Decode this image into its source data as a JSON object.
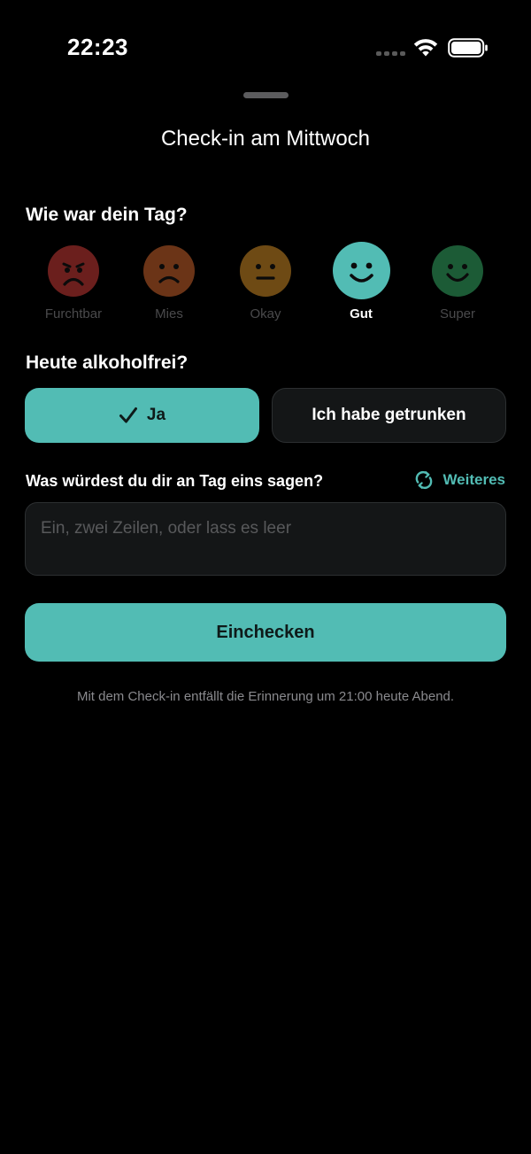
{
  "status_bar": {
    "time": "22:23"
  },
  "sheet": {
    "title": "Check-in am Mittwoch"
  },
  "mood": {
    "question": "Wie war dein Tag?",
    "selected": "Gut",
    "options": [
      {
        "label": "Furchtbar",
        "color": "#6b1f1d",
        "icon": "very-sad-face-icon"
      },
      {
        "label": "Mies",
        "color": "#6b3417",
        "icon": "sad-face-icon"
      },
      {
        "label": "Okay",
        "color": "#6e4a14",
        "icon": "neutral-face-icon"
      },
      {
        "label": "Gut",
        "color": "#52bcb4",
        "icon": "happy-face-icon"
      },
      {
        "label": "Super",
        "color": "#1c5b36",
        "icon": "very-happy-face-icon"
      }
    ]
  },
  "alcohol": {
    "question": "Heute alkoholfrei?",
    "yes_label": "Ja",
    "no_label": "Ich habe getrunken",
    "selected": "Ja"
  },
  "prompt": {
    "question": "Was würdest du dir an Tag eins sagen?",
    "more_label": "Weiteres",
    "placeholder": "Ein, zwei Zeilen, oder lass es leer"
  },
  "actions": {
    "submit_label": "Einchecken"
  },
  "footnote": "Mit dem Check-in entfällt die Erinnerung um 21:00 heute Abend.",
  "colors": {
    "accent": "#52bcb4",
    "background": "#000000",
    "surface": "#141617"
  }
}
